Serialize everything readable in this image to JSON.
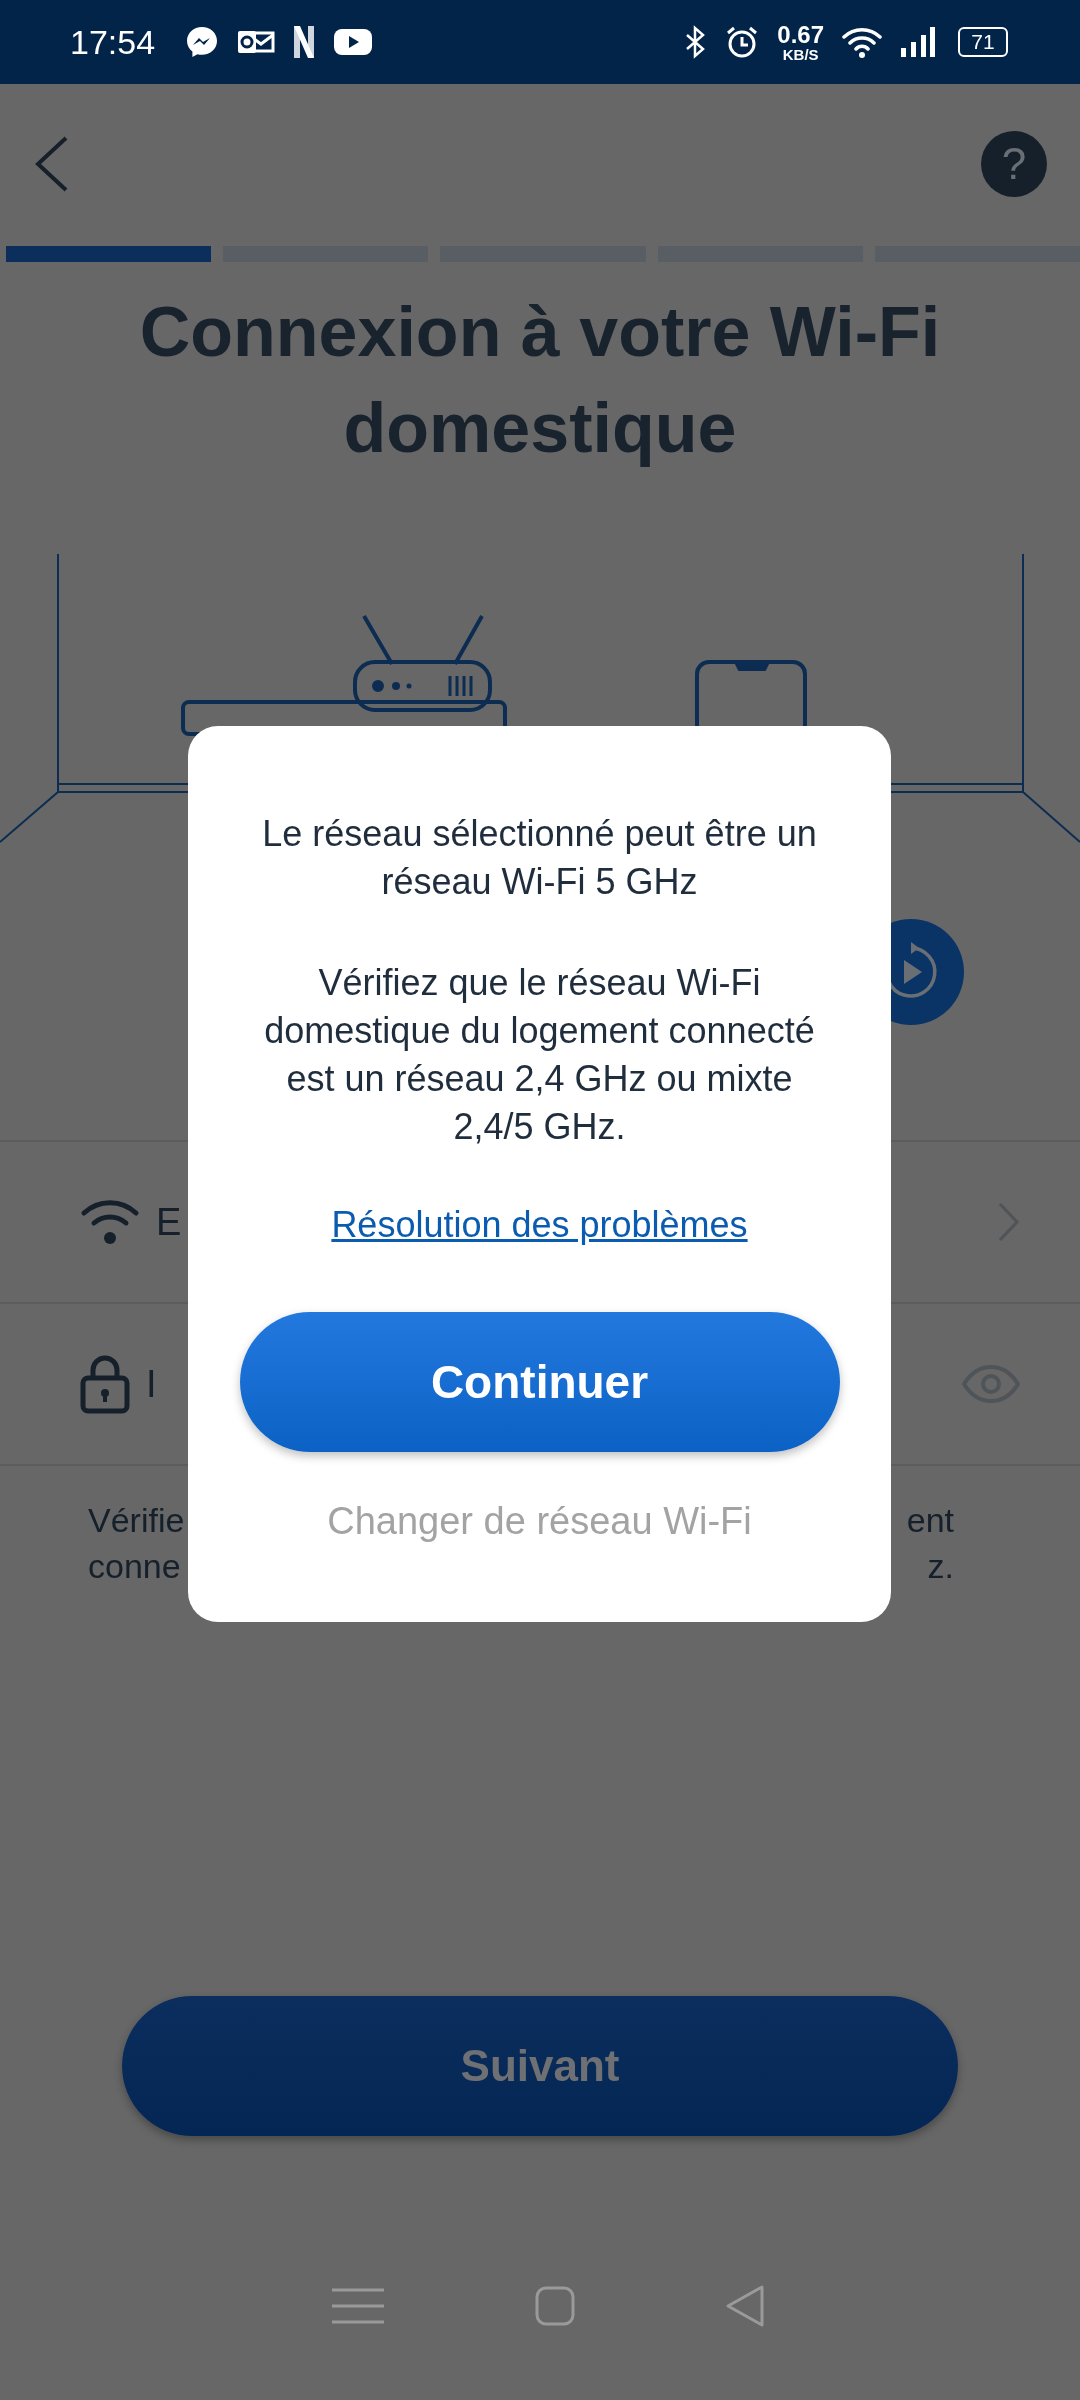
{
  "status_bar": {
    "time": "17:54",
    "speed_value": "0.67",
    "speed_unit": "KB/S",
    "battery": "71"
  },
  "header": {
    "help_label": "?"
  },
  "progress": [
    {
      "active": true
    },
    {
      "active": false
    },
    {
      "active": false
    },
    {
      "active": false
    },
    {
      "active": false
    }
  ],
  "title": "Connexion à votre Wi-Fi domestique",
  "form_rows": [
    {
      "kind": "network",
      "label": "E"
    },
    {
      "kind": "password",
      "label": "I"
    }
  ],
  "note_lines": [
    {
      "left": "Vérifie",
      "right": "ent"
    },
    {
      "left": "conne",
      "right": "z."
    }
  ],
  "dialog": {
    "paragraphs": [
      "Le réseau sélectionné peut être un réseau Wi-Fi 5 GHz",
      "Vérifiez que le réseau Wi-Fi domestique du logement connecté est un réseau 2,4 GHz ou mixte 2,4/5 GHz."
    ],
    "link": "Résolution des problèmes",
    "primary_button": "Continuer",
    "secondary_button": "Changer de réseau Wi-Fi"
  },
  "next_button": "Suivant"
}
